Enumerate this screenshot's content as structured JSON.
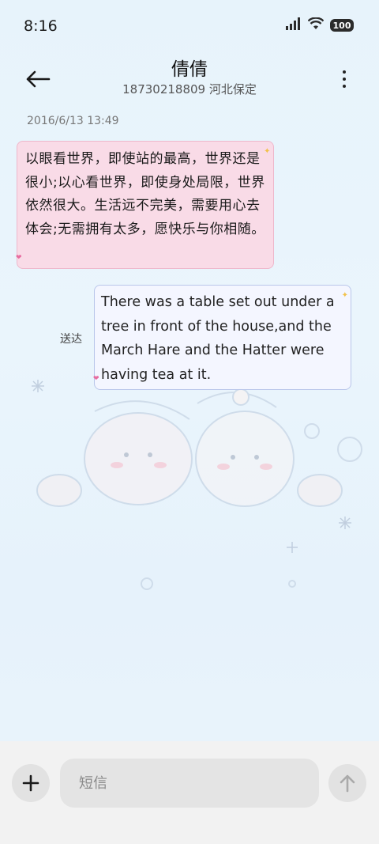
{
  "status_bar": {
    "time": "8:16",
    "battery": "100"
  },
  "header": {
    "contact_name": "倩倩",
    "contact_detail": "18730218809 河北保定"
  },
  "conversation": {
    "timestamp": "2016/6/13 13:49",
    "incoming_message": "以眼看世界，即使站的最高，世界还是很小;以心看世界，即使身处局限，世界依然很大。生活远不完美，需要用心去体会;无需拥有太多，愿快乐与你相随。",
    "outgoing_message": "There was a table set out under a tree in front of the house,and the March Hare and the Hatter were having tea at it.",
    "outgoing_status": "送达"
  },
  "composer": {
    "placeholder": "短信"
  },
  "icons": {
    "back": "arrow-left-icon",
    "more": "more-vertical-icon",
    "add": "plus-icon",
    "send": "arrow-up-icon"
  }
}
